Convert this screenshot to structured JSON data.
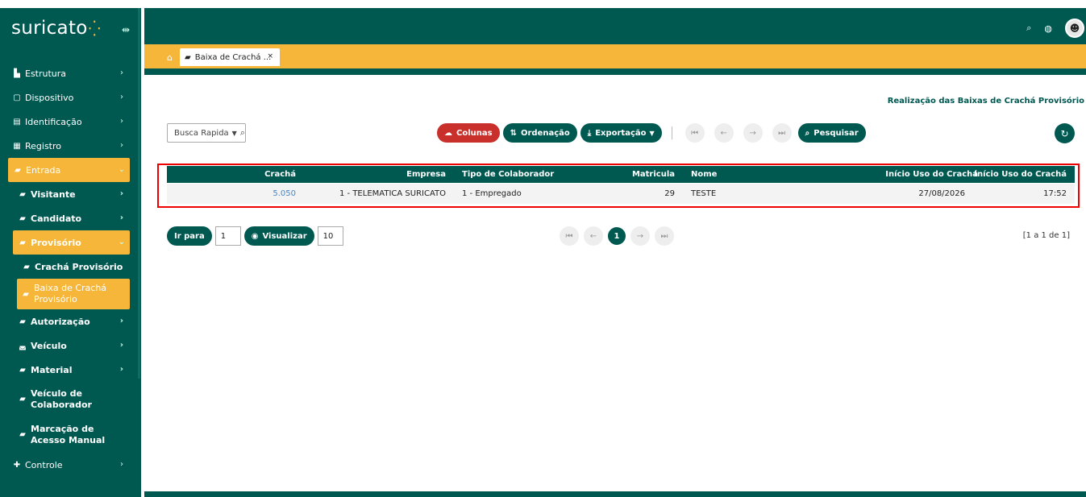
{
  "app": {
    "logo_text": "suricato",
    "logo_mark": "⁛"
  },
  "sidebar": {
    "items": [
      {
        "label": "Estrutura",
        "icon": "building-icon"
      },
      {
        "label": "Dispositivo",
        "icon": "device-icon"
      },
      {
        "label": "Identificação",
        "icon": "id-card-icon"
      },
      {
        "label": "Registro",
        "icon": "register-icon"
      },
      {
        "label": "Entrada",
        "icon": "badge-icon"
      },
      {
        "label": "Visitante",
        "icon": "badge-icon"
      },
      {
        "label": "Candidato",
        "icon": "badge-icon"
      },
      {
        "label": "Provisório",
        "icon": "badge-icon"
      },
      {
        "label": "Crachá Provisório",
        "icon": "badge-icon"
      },
      {
        "label": "Baixa de Crachá Provisório",
        "icon": "badge-icon"
      },
      {
        "label": "Autorização",
        "icon": "badge-icon"
      },
      {
        "label": "Veículo",
        "icon": "car-icon"
      },
      {
        "label": "Material",
        "icon": "badge-icon"
      },
      {
        "label": "Veículo de Colaborador",
        "icon": "badge-icon"
      },
      {
        "label": "Marcação de Acesso Manual",
        "icon": "badge-icon"
      },
      {
        "label": "Controle",
        "icon": "puzzle-icon"
      }
    ]
  },
  "tabs": {
    "active_label": "Baixa de Crachá ...",
    "close": "×"
  },
  "page": {
    "title": "Realização das Baixas de Crachá Provisório"
  },
  "toolbar": {
    "search_label": "Busca Rapida",
    "colunas": "Colunas",
    "ordenacao": "Ordenação",
    "exportacao": "Exportação",
    "pesquisar": "Pesquisar"
  },
  "table": {
    "headers": {
      "cracha": "Crachá",
      "empresa": "Empresa",
      "tipo": "Tipo de Colaborador",
      "matricula": "Matricula",
      "nome": "Nome",
      "inicio_data": "Início Uso do Crachá",
      "inicio_hora": "Início Uso do Crachá"
    },
    "rows": [
      {
        "cracha": "5.050",
        "empresa": "1 - TELEMATICA SURICATO",
        "tipo": "1 - Empregado",
        "matricula": "29",
        "nome": "TESTE",
        "inicio_data": "27/08/2026",
        "inicio_hora": "17:52"
      }
    ]
  },
  "pager": {
    "ir_para": "Ir para",
    "page_input": "1",
    "visualizar": "Visualizar",
    "page_size": "10",
    "current_page": "1",
    "info": "[1 a 1 de 1]"
  },
  "colors": {
    "primary": "#005951",
    "accent": "#f5b63a",
    "danger": "#c9302c"
  }
}
